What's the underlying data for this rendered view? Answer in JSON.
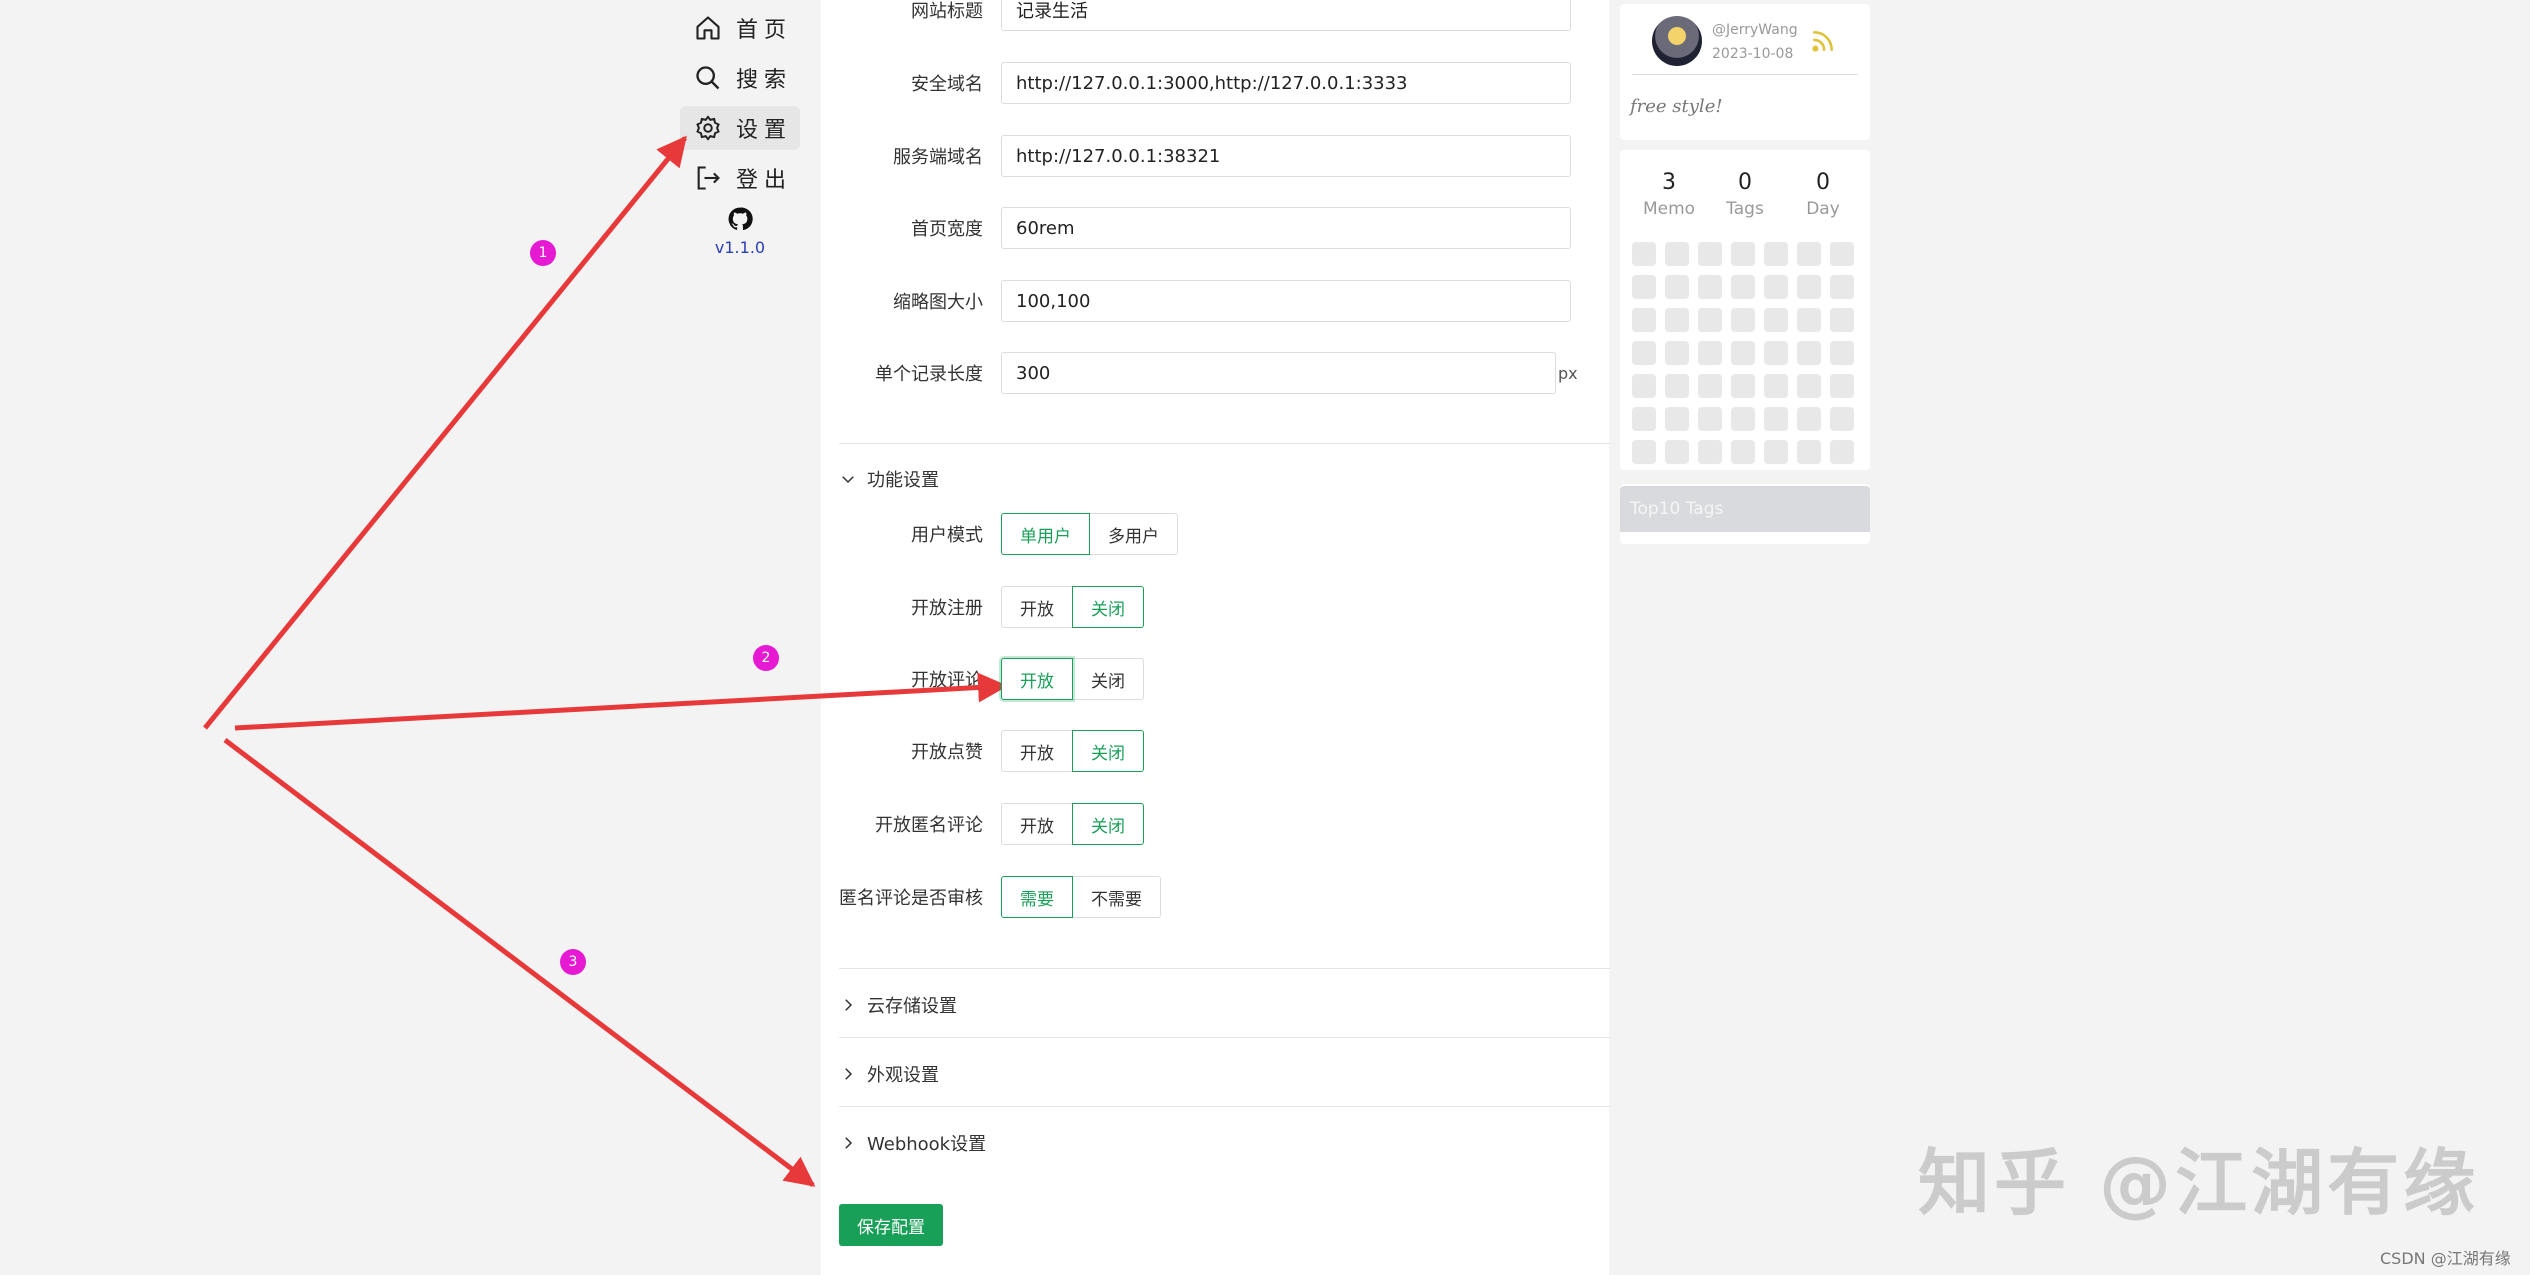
{
  "nav": {
    "items": [
      {
        "label": "首页",
        "icon": "home-icon"
      },
      {
        "label": "搜索",
        "icon": "search-icon"
      },
      {
        "label": "设置",
        "icon": "gear-icon",
        "active": true
      },
      {
        "label": "登出",
        "icon": "logout-icon"
      }
    ],
    "github_icon": "github-icon",
    "version": "v1.1.0"
  },
  "form": {
    "site_title": {
      "label": "网站标题",
      "value": "记录生活"
    },
    "safe_domain": {
      "label": "安全域名",
      "value": "http://127.0.0.1:3000,http://127.0.0.1:3333"
    },
    "server_domain": {
      "label": "服务端域名",
      "value": "http://127.0.0.1:38321"
    },
    "home_width": {
      "label": "首页宽度",
      "value": "60rem"
    },
    "thumb_size": {
      "label": "缩略图大小",
      "value": "100,100"
    },
    "memo_length": {
      "label": "单个记录长度",
      "value": "300",
      "unit": "px"
    }
  },
  "feature_section": {
    "title": "功能设置",
    "rows": [
      {
        "label": "用户模式",
        "options": [
          "单用户",
          "多用户"
        ],
        "selected": 0
      },
      {
        "label": "开放注册",
        "options": [
          "开放",
          "关闭"
        ],
        "selected": 1
      },
      {
        "label": "开放评论",
        "options": [
          "开放",
          "关闭"
        ],
        "selected": 0
      },
      {
        "label": "开放点赞",
        "options": [
          "开放",
          "关闭"
        ],
        "selected": 1
      },
      {
        "label": "开放匿名评论",
        "options": [
          "开放",
          "关闭"
        ],
        "selected": 1
      },
      {
        "label": "匿名评论是否审核",
        "options": [
          "需要",
          "不需要"
        ],
        "selected": 0
      }
    ]
  },
  "sections": {
    "storage": "云存储设置",
    "appearance": "外观设置",
    "webhook": "Webhook设置"
  },
  "save_button": "保存配置",
  "profile": {
    "username": "@JerryWang",
    "date": "2023-10-08",
    "bio": "free style!"
  },
  "stats": [
    {
      "num": "3",
      "name": "Memo"
    },
    {
      "num": "0",
      "name": "Tags"
    },
    {
      "num": "0",
      "name": "Day"
    }
  ],
  "top_tags": "Top10 Tags",
  "annotations": [
    "1",
    "2",
    "3"
  ],
  "watermark": "知乎 @江湖有缘",
  "credit": "CSDN @江湖有缘",
  "colors": {
    "accent": "#18a058",
    "arrow": "#e8393a",
    "badge": "#e61ad2"
  }
}
